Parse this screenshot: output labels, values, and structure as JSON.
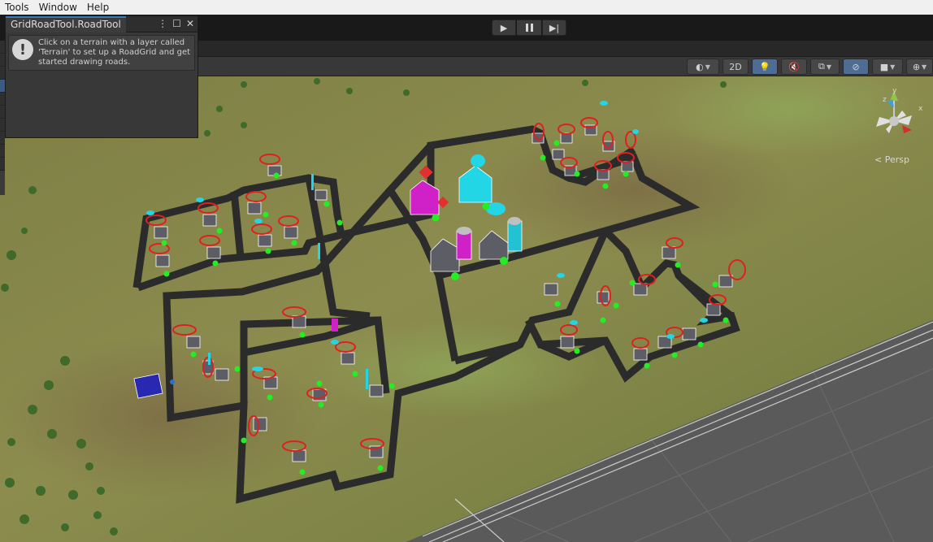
{
  "menu": {
    "items": [
      "Tools",
      "Window",
      "Help"
    ]
  },
  "play_controls": {
    "play_icon": "play-icon",
    "pause_icon": "pause-icon",
    "step_icon": "step-icon"
  },
  "scene_toolbar": {
    "toggle_2d": "2D"
  },
  "tool_window": {
    "tab_title": "GridRoadTool.RoadTool",
    "menu_glyph": "⋮",
    "maximize_glyph": "☐",
    "close_glyph": "✕",
    "help_icon": "!",
    "message": "Click on a terrain with a layer called 'Terrain' to set up a RoadGrid and get started drawing roads."
  },
  "gizmo": {
    "projection_label": "< Persp",
    "x_label": "x",
    "y_label": "y",
    "z_label": "z"
  },
  "colors": {
    "terrain": "#8a8a48",
    "road": "#2e2e2e",
    "node": "#22ee22",
    "house_red": "#e02020",
    "house_cyan": "#22d6e6",
    "barn_magenta": "#d020c8",
    "accent_blue": "#3a79bb"
  }
}
